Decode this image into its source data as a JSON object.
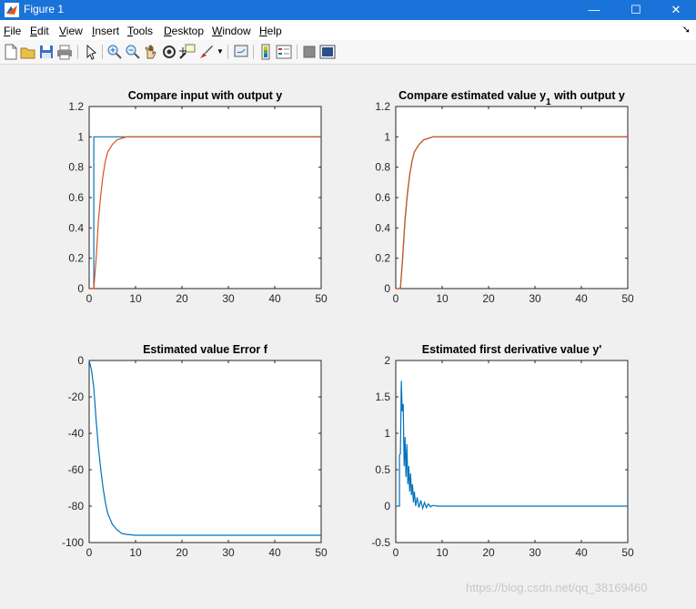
{
  "window": {
    "title": "Figure 1",
    "controls": {
      "minimize": "—",
      "maximize": "☐",
      "close": "✕"
    }
  },
  "menu": [
    {
      "label": "File",
      "mnemonic": "F",
      "rest": "ile"
    },
    {
      "label": "Edit",
      "mnemonic": "E",
      "rest": "dit"
    },
    {
      "label": "View",
      "mnemonic": "V",
      "rest": "iew"
    },
    {
      "label": "Insert",
      "mnemonic": "I",
      "rest": "nsert"
    },
    {
      "label": "Tools",
      "mnemonic": "T",
      "rest": "ools"
    },
    {
      "label": "Desktop",
      "mnemonic": "D",
      "rest": "esktop"
    },
    {
      "label": "Window",
      "mnemonic": "W",
      "rest": "indow"
    },
    {
      "label": "Help",
      "mnemonic": "H",
      "rest": "elp"
    }
  ],
  "toolbar_icons": [
    "new-figure-icon",
    "open-file-icon",
    "save-icon",
    "print-icon",
    "pointer-icon",
    "zoom-in-icon",
    "zoom-out-icon",
    "pan-icon",
    "rotate-icon",
    "data-cursor-icon",
    "brush-icon",
    "link-plot-icon",
    "colorbar-icon",
    "legend-icon",
    "hide-plot-tools-icon",
    "show-plot-tools-icon"
  ],
  "watermark": "https://blog.csdn.net/qq_38169460",
  "chart_data": [
    {
      "type": "line",
      "title": "Compare input with output y",
      "xlim": [
        0,
        50
      ],
      "ylim": [
        0,
        1.2
      ],
      "xticks": [
        "0",
        "10",
        "20",
        "30",
        "40",
        "50"
      ],
      "yticks": [
        "0",
        "0.2",
        "0.4",
        "0.6",
        "0.8",
        "1",
        "1.2"
      ],
      "series": [
        {
          "color": "#0072bd",
          "x": [
            0,
            1,
            1,
            50
          ],
          "y": [
            0,
            0,
            1,
            1
          ]
        },
        {
          "color": "#d95319",
          "x": [
            0,
            1,
            1.5,
            2,
            2.5,
            3,
            3.5,
            4,
            5,
            6,
            7,
            8,
            10,
            50
          ],
          "y": [
            0,
            0,
            0.2,
            0.45,
            0.62,
            0.75,
            0.84,
            0.9,
            0.95,
            0.98,
            0.99,
            1.0,
            1.0,
            1.0
          ]
        }
      ]
    },
    {
      "type": "line",
      "title": "Compare estimated value y",
      "title_sub": "1",
      "title_tail": " with output y",
      "xlim": [
        0,
        50
      ],
      "ylim": [
        0,
        1.2
      ],
      "xticks": [
        "0",
        "10",
        "20",
        "30",
        "40",
        "50"
      ],
      "yticks": [
        "0",
        "0.2",
        "0.4",
        "0.6",
        "0.8",
        "1",
        "1.2"
      ],
      "series": [
        {
          "color": "#0072bd",
          "x": [
            0,
            1,
            1.5,
            2,
            2.5,
            3,
            3.5,
            4,
            5,
            6,
            7,
            8,
            10,
            50
          ],
          "y": [
            0,
            0,
            0.2,
            0.45,
            0.62,
            0.75,
            0.84,
            0.9,
            0.95,
            0.98,
            0.99,
            1.0,
            1.0,
            1.0
          ]
        },
        {
          "color": "#d95319",
          "x": [
            0,
            1,
            1.5,
            2,
            2.5,
            3,
            3.5,
            4,
            5,
            6,
            7,
            8,
            10,
            50
          ],
          "y": [
            0,
            0,
            0.21,
            0.46,
            0.63,
            0.75,
            0.84,
            0.9,
            0.95,
            0.98,
            0.99,
            1.0,
            1.0,
            1.0
          ]
        }
      ]
    },
    {
      "type": "line",
      "title": "Estimated value Error f",
      "xlim": [
        0,
        50
      ],
      "ylim": [
        -100,
        0
      ],
      "xticks": [
        "0",
        "10",
        "20",
        "30",
        "40",
        "50"
      ],
      "yticks": [
        "-100",
        "-80",
        "-60",
        "-40",
        "-20",
        "0"
      ],
      "series": [
        {
          "color": "#0072bd",
          "x": [
            0,
            0.5,
            1,
            1.5,
            2,
            2.5,
            3,
            3.5,
            4,
            5,
            6,
            7,
            8,
            10,
            15,
            50
          ],
          "y": [
            0,
            -5,
            -15,
            -33,
            -48,
            -60,
            -70,
            -78,
            -84,
            -90,
            -93,
            -95,
            -95.5,
            -96,
            -96,
            -96
          ]
        }
      ]
    },
    {
      "type": "line",
      "title": "Estimated first derivative value y'",
      "xlim": [
        0,
        50
      ],
      "ylim": [
        -0.5,
        2
      ],
      "xticks": [
        "0",
        "10",
        "20",
        "30",
        "40",
        "50"
      ],
      "yticks": [
        "-0.5",
        "0",
        "0.5",
        "1",
        "1.5",
        "2"
      ],
      "series": [
        {
          "color": "#0072bd",
          "x": [
            0,
            0.8,
            0.8,
            1.0,
            1.2,
            1.4,
            1.6,
            1.8,
            2.0,
            2.2,
            2.4,
            2.6,
            2.8,
            3.0,
            3.2,
            3.4,
            3.6,
            3.8,
            4.0,
            4.3,
            4.6,
            5.0,
            5.4,
            5.8,
            6.2,
            6.6,
            7.0,
            7.5,
            8,
            9,
            10,
            12,
            50
          ],
          "y": [
            0,
            0,
            0.7,
            0.72,
            1.72,
            1.3,
            1.4,
            0.55,
            0.95,
            0.4,
            0.85,
            0.3,
            0.55,
            0.2,
            0.45,
            0.15,
            0.3,
            0.05,
            0.2,
            0.0,
            0.12,
            -0.02,
            0.08,
            -0.03,
            0.05,
            -0.02,
            0.03,
            -0.01,
            0.01,
            0.0,
            0.0,
            0.0,
            0.0
          ]
        }
      ]
    }
  ]
}
